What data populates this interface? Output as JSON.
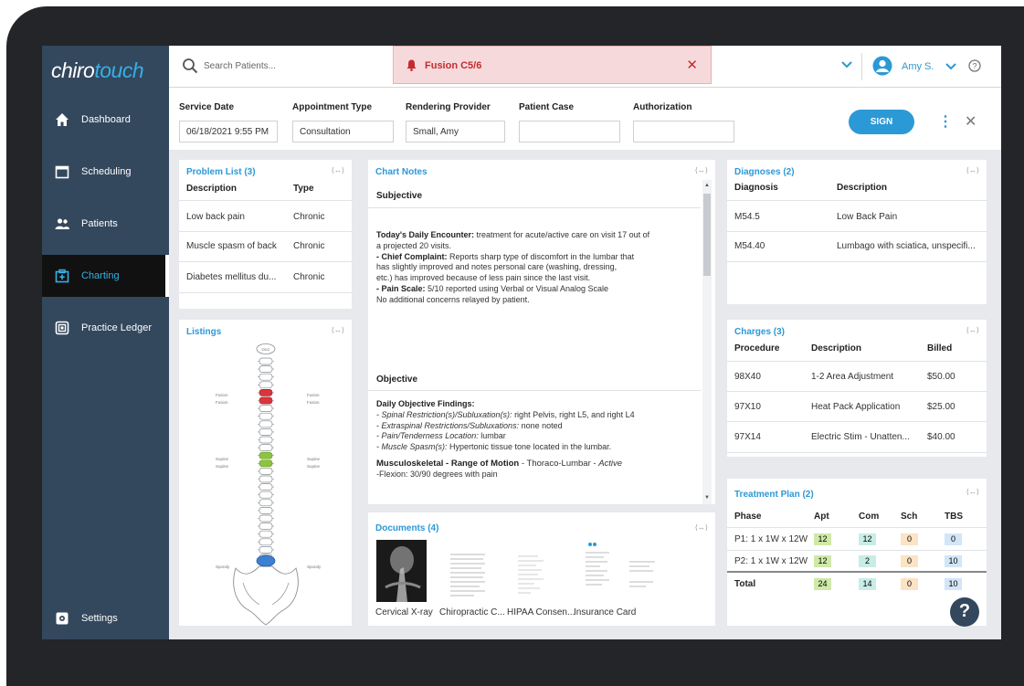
{
  "app": {
    "logo_left": "chiro",
    "logo_right": "touch"
  },
  "sidebar": {
    "items": [
      {
        "label": "Dashboard",
        "icon": "home-icon"
      },
      {
        "label": "Scheduling",
        "icon": "calendar-icon"
      },
      {
        "label": "Patients",
        "icon": "people-icon"
      },
      {
        "label": "Charting",
        "icon": "chart-folder-icon"
      },
      {
        "label": "Practice Ledger",
        "icon": "ledger-icon"
      }
    ],
    "settings": "Settings"
  },
  "topbar": {
    "search_placeholder": "Search Patients...",
    "alert": "Fusion C5/6",
    "user": "Amy S."
  },
  "service": {
    "service_date_label": "Service Date",
    "service_date": "06/18/2021 9:55 PM",
    "appt_type_label": "Appointment Type",
    "appt_type": "Consultation",
    "provider_label": "Rendering Provider",
    "provider": "Small, Amy",
    "case_label": "Patient Case",
    "case": "",
    "auth_label": "Authorization",
    "auth": "",
    "sign": "SIGN"
  },
  "problems": {
    "title": "Problem List (3)",
    "col1": "Description",
    "col2": "Type",
    "rows": [
      {
        "d": "Low back pain",
        "t": "Chronic"
      },
      {
        "d": "Muscle spasm of back",
        "t": "Chronic"
      },
      {
        "d": "Diabetes mellitus du...",
        "t": "Chronic"
      }
    ]
  },
  "listings": {
    "title": "Listings",
    "left_labels": [
      "Fusion",
      "Fusion",
      "Supine",
      "Supine",
      "Spondy"
    ],
    "right_labels": [
      "Fusion",
      "Fusion",
      "Supine",
      "Supine",
      "Spondy"
    ],
    "top_label": "OCC"
  },
  "notes": {
    "title": "Chart Notes",
    "subjective": "Subjective",
    "l1a": "Today's Daily Encounter:",
    "l1b": " treatment for acute/active care on visit 17 out of",
    "l2": "a projected 20 visits.",
    "l3a": " - Chief Complaint:",
    "l3b": " Reports sharp type of discomfort in the lumbar that",
    "l4": "has slightly improved and notes personal care (washing, dressing,",
    "l5": "etc.) has improved because of less pain since the last visit.",
    "l6a": "- Pain Scale:",
    "l6b": " 5/10 reported using Verbal or Visual Analog Scale",
    "l7": "No additional concerns relayed by patient.",
    "objective": "Objective",
    "o1": "Daily Objective Findings:",
    "o2a": "- Spinal Restriction(s)/Subluxation(s):",
    "o2b": " right Pelvis, right L5, and right L4",
    "o3a": "- Extraspinal Restrictions/Subluxations:",
    "o3b": " none noted",
    "o4a": "- Pain/Tenderness Location:",
    "o4b": " lumbar",
    "o5a": "- Muscle Spasm(s):",
    "o5b": " Hypertonic tissue tone located in the lumbar.",
    "o6a": "Musculoskeletal - Range of Motion",
    "o6b": " - Thoraco-Lumbar - ",
    "o6c": "Active",
    "o7": "-Flexion: 30/90 degrees with pain"
  },
  "documents": {
    "title": "Documents (4)",
    "items": [
      "Cervical X-ray",
      "Chiropractic C...",
      "HIPAA Consen...",
      "Insurance Card"
    ]
  },
  "diagnoses": {
    "title": "Diagnoses (2)",
    "col1": "Diagnosis",
    "col2": "Description",
    "rows": [
      {
        "c": "M54.5",
        "d": "Low Back Pain"
      },
      {
        "c": "M54.40",
        "d": "Lumbago with sciatica, unspecifi..."
      }
    ]
  },
  "charges": {
    "title": "Charges (3)",
    "col1": "Procedure",
    "col2": "Description",
    "col3": "Billed",
    "rows": [
      {
        "p": "98X40",
        "d": "1-2 Area Adjustment",
        "b": "$50.00"
      },
      {
        "p": "97X10",
        "d": "Heat Pack Application",
        "b": "$25.00"
      },
      {
        "p": "97X14",
        "d": "Electric Stim - Unatten...",
        "b": "$40.00"
      }
    ]
  },
  "treatment": {
    "title": "Treatment Plan (2)",
    "cols": [
      "Phase",
      "Apt",
      "Com",
      "Sch",
      "TBS"
    ],
    "rows": [
      {
        "phase": "P1: 1 x 1W x 12W",
        "apt": "12",
        "com": "12",
        "sch": "0",
        "tbs": "0"
      },
      {
        "phase": "P2: 1 x 1W x 12W",
        "apt": "12",
        "com": "2",
        "sch": "0",
        "tbs": "10"
      }
    ],
    "total": {
      "phase": "Total",
      "apt": "24",
      "com": "14",
      "sch": "0",
      "tbs": "10"
    }
  },
  "colors": {
    "accent": "#2b99d6",
    "sidebar": "#33475d",
    "alert_bg": "#f6dadb",
    "alert_text": "#c62a2f",
    "fusion": "#d9363b",
    "supine": "#8cc43f",
    "spondy": "#3d7fd1"
  },
  "help": "?"
}
